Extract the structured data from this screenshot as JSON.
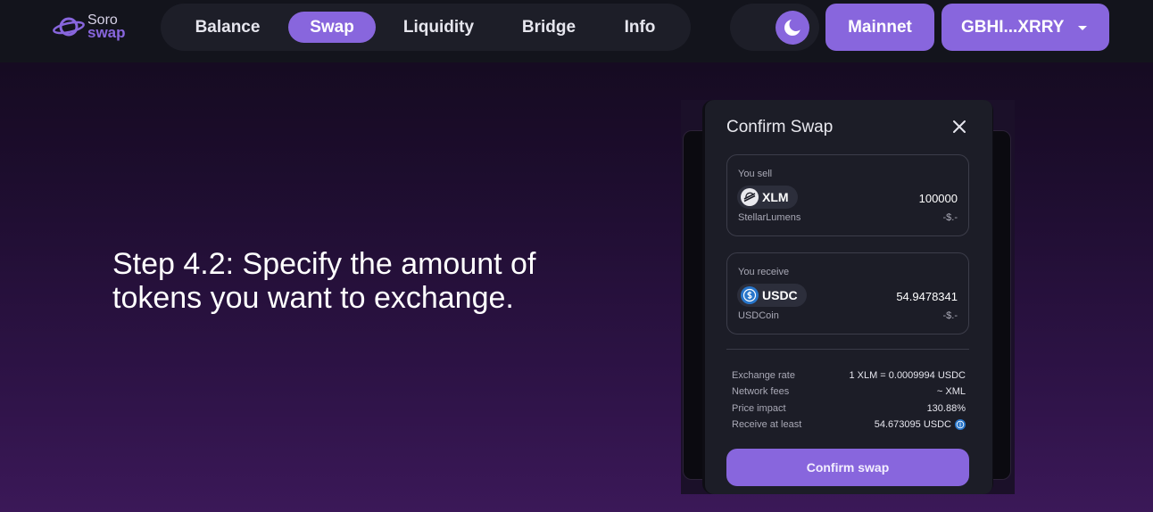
{
  "logo": {
    "line1": "Soro",
    "line2": "swap"
  },
  "nav": {
    "tabs": [
      {
        "label": "Balance"
      },
      {
        "label": "Swap"
      },
      {
        "label": "Liquidity"
      },
      {
        "label": "Bridge"
      },
      {
        "label": "Info"
      }
    ],
    "active_tab": "Swap",
    "network_label": "Mainnet",
    "wallet_label": "GBHI...XRRY"
  },
  "hero": {
    "step_text": "Step 4.2: Specify the amount of tokens you want to exchange."
  },
  "modal": {
    "title": "Confirm Swap",
    "sell": {
      "label": "You sell",
      "token": "XLM",
      "amount": "100000",
      "token_name": "StellarLumens",
      "usd_value": "-$.-"
    },
    "receive": {
      "label": "You receive",
      "token": "USDC",
      "amount": "54.9478341",
      "token_name": "USDCoin",
      "usd_value": "-$.-"
    },
    "details": [
      {
        "label": "Exchange rate",
        "value": "1 XLM = 0.0009994 USDC"
      },
      {
        "label": "Network fees",
        "value": "~ XML"
      },
      {
        "label": "Price impact",
        "value": "130.88%"
      },
      {
        "label": "Receive at least",
        "value": "54.673095 USDC"
      }
    ],
    "confirm_label": "Confirm swap"
  },
  "colors": {
    "accent": "#8866dd",
    "nav_bg": "#13141c",
    "modal_bg": "#1c1d27",
    "usdc_blue": "#2775ca"
  }
}
